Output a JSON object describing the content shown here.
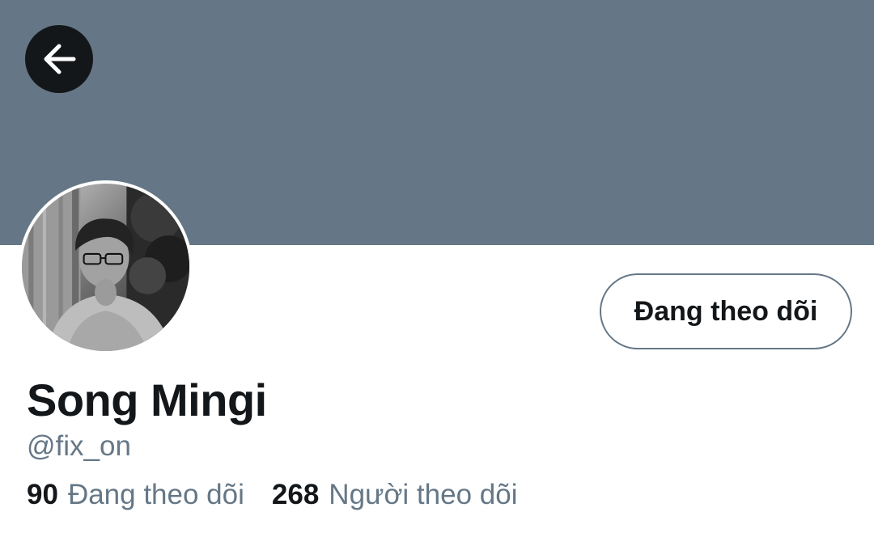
{
  "header": {
    "back_icon": "arrow-left-icon",
    "banner_color": "#657786"
  },
  "profile": {
    "avatar_icon": "profile-photo",
    "follow_button_label": "Đang theo dõi",
    "display_name": "Song Mingi",
    "handle": "@fix_on"
  },
  "stats": {
    "following_count": "90",
    "following_label": "Đang theo dõi",
    "followers_count": "268",
    "followers_label": "Người theo dõi"
  },
  "colors": {
    "text_primary": "#14171a",
    "text_secondary": "#657786"
  }
}
